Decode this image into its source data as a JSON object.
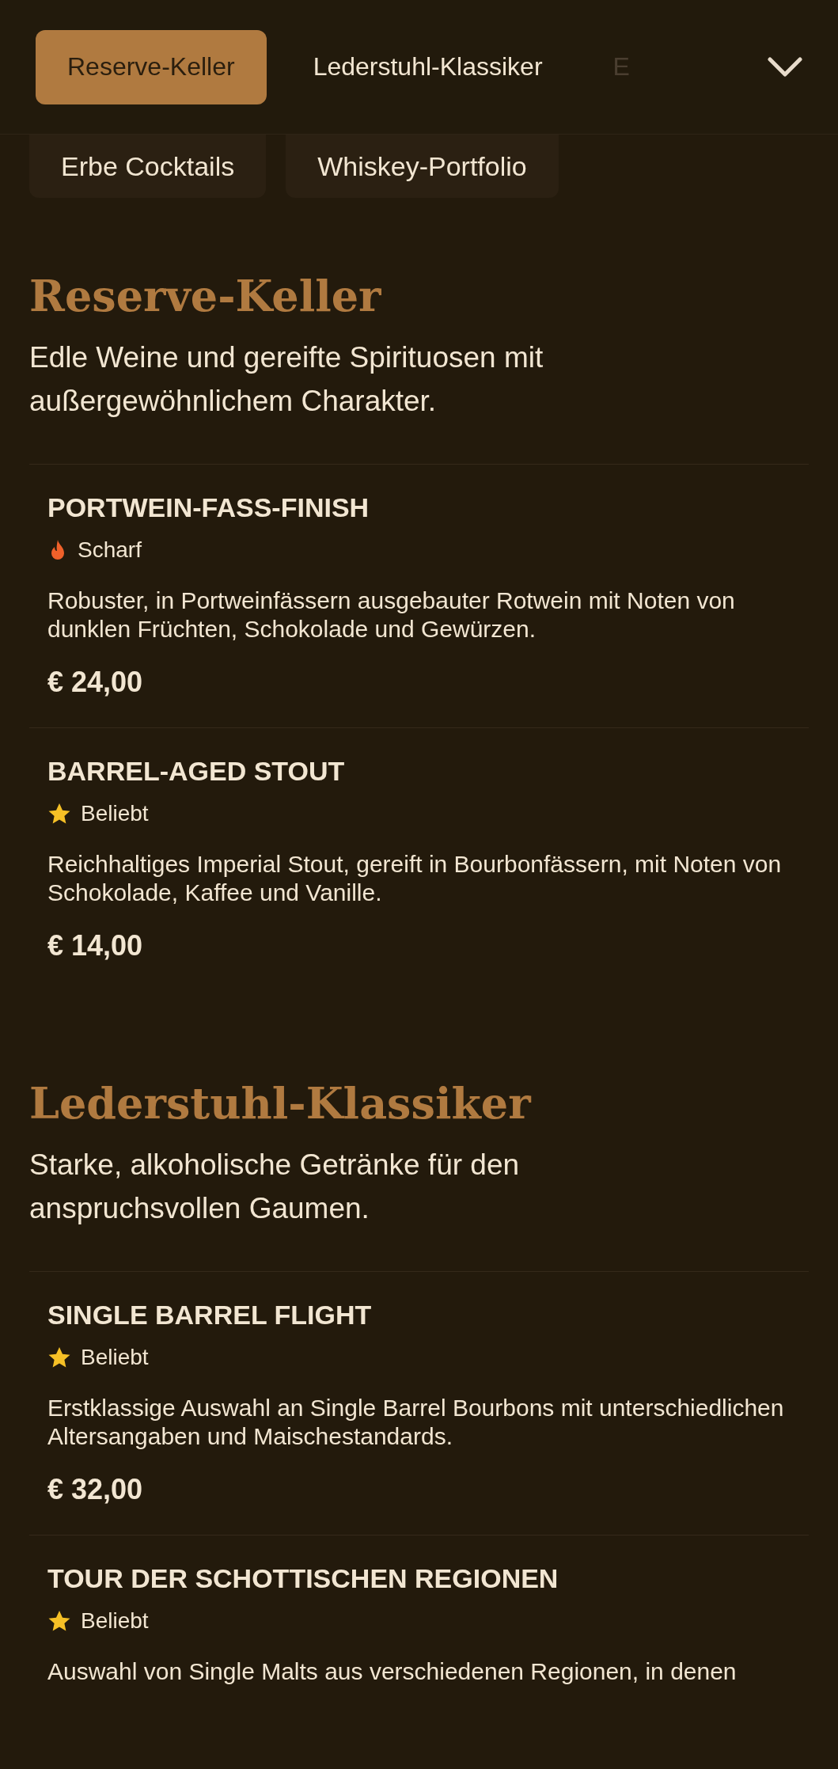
{
  "tabs": [
    {
      "label": "Reserve-Keller",
      "selected": true
    },
    {
      "label": "Lederstuhl-Klassiker",
      "selected": false
    },
    {
      "label": "E",
      "selected": false
    }
  ],
  "tabs_row_2": [
    {
      "label": "Erbe Cocktails",
      "selected": false
    },
    {
      "label": "Whiskey-Portfolio",
      "selected": false
    }
  ],
  "sections": [
    {
      "title": "Reserve-Keller",
      "subtitle": "Edle Weine und gereifte Spirituosen mit außergewöhnlichem Charakter.",
      "items": [
        {
          "name": "PORTWEIN-FASS-FINISH",
          "tag": {
            "kind": "spicy",
            "label": "Scharf"
          },
          "description": "Robuster, in Portweinfässern ausgebauter Rotwein mit Noten von dunklen Früchten, Schokolade und Gewürzen.",
          "price": "€ 24,00"
        },
        {
          "name": "BARREL-AGED STOUT",
          "tag": {
            "kind": "popular",
            "label": "Beliebt"
          },
          "description": "Reichhaltiges Imperial Stout, gereift in Bourbonfässern, mit Noten von Schokolade, Kaffee und Vanille.",
          "price": "€ 14,00"
        }
      ]
    },
    {
      "title": "Lederstuhl-Klassiker",
      "subtitle": "Starke, alkoholische Getränke für den anspruchsvollen Gaumen.",
      "items": [
        {
          "name": "SINGLE BARREL FLIGHT",
          "tag": {
            "kind": "popular",
            "label": "Beliebt"
          },
          "description": "Erstklassige Auswahl an Single Barrel Bourbons mit unterschiedlichen Altersangaben und Maischestandards.",
          "price": "€ 32,00"
        },
        {
          "name": "TOUR DER SCHOTTISCHEN REGIONEN",
          "tag": {
            "kind": "popular",
            "label": "Beliebt"
          },
          "description": "Auswahl von Single Malts aus verschiedenen Regionen, in denen"
        }
      ]
    }
  ]
}
